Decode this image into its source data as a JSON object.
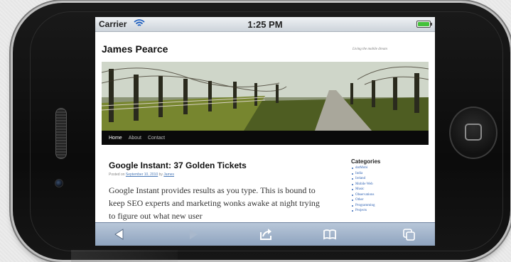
{
  "status_bar": {
    "carrier": "Carrier",
    "time": "1:25 PM"
  },
  "site": {
    "title": "James Pearce",
    "description": "Living the mobile dream",
    "nav": [
      "Home",
      "About",
      "Contact"
    ]
  },
  "post": {
    "title": "Google Instant: 37 Golden Tickets",
    "meta": {
      "prefix": "Posted on",
      "date": "September 10, 2010",
      "by": "by",
      "author": "James"
    },
    "body": "Google Instant provides results as you type. This is bound to keep SEO experts and marketing wonks awake at night trying to figure out what new user"
  },
  "sidebar": {
    "widget_title": "Categories",
    "categories": [
      "dotMobi",
      "India",
      "Ireland",
      "Mobile Web",
      "Music",
      "Observations",
      "Other",
      "Programming",
      "Projects"
    ]
  },
  "toolbar": {
    "buttons": [
      "back-icon",
      "forward-icon",
      "share-icon",
      "bookmarks-icon",
      "pages-icon"
    ]
  },
  "colors": {
    "nav_bg": "#0a0a0a",
    "toolbar": "#9fb1c8",
    "link": "#2f62b3",
    "battery": "#43c13a"
  }
}
